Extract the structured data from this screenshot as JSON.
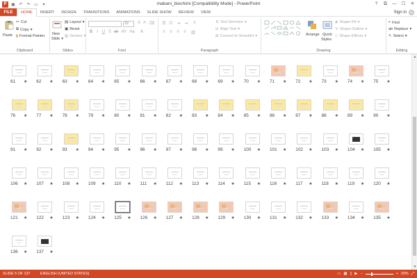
{
  "window": {
    "title": "mabani_biochimi [Compatibility Mode] - PowerPoint",
    "app_logo": "P",
    "qat": [
      "save-icon",
      "undo-icon",
      "redo-icon",
      "present-icon",
      "customize-icon"
    ],
    "controls": [
      "?",
      "⧉",
      "—",
      "☐",
      "✕"
    ]
  },
  "tabs": {
    "file": "FILE",
    "items": [
      "HOME",
      "INSERT",
      "DESIGN",
      "TRANSITIONS",
      "ANIMATIONS",
      "SLIDE SHOW",
      "REVIEW",
      "VIEW"
    ],
    "active": "HOME",
    "signin": "Sign in"
  },
  "ribbon": {
    "clipboard": {
      "label": "Clipboard",
      "paste": "Paste",
      "cut": "Cut",
      "copy": "Copy",
      "format_painter": "Format Painter"
    },
    "slides": {
      "label": "Slides",
      "new_slide": "New",
      "new_slide_2": "Slide",
      "layout": "Layout",
      "reset": "Reset",
      "section": "Section"
    },
    "font": {
      "label": "Font",
      "font_name": "",
      "font_size": "22"
    },
    "paragraph": {
      "label": "Paragraph",
      "text_direction": "Text Direction",
      "align_text": "Align Text",
      "convert_smartart": "Convert to SmartArt"
    },
    "drawing": {
      "label": "Drawing",
      "arrange": "Arrange",
      "quick_styles": "Quick",
      "quick_styles_2": "Styles",
      "shape_fill": "Shape Fill",
      "shape_outline": "Shape Outline",
      "shape_effects": "Shape Effects"
    },
    "editing": {
      "label": "Editing",
      "find": "Find",
      "replace": "Replace",
      "select": "Select"
    }
  },
  "slides": {
    "star": "★",
    "selected": 125,
    "rows": [
      [
        61,
        62,
        63,
        64,
        65,
        66,
        67,
        68,
        69,
        70,
        71,
        72,
        73,
        74,
        75
      ],
      [
        76,
        77,
        78,
        79,
        80,
        81,
        82,
        83,
        84,
        85,
        86,
        87,
        88,
        89,
        90
      ],
      [
        91,
        92,
        93,
        94,
        95,
        96,
        97,
        98,
        99,
        100,
        101,
        102,
        103,
        104,
        105
      ],
      [
        106,
        107,
        108,
        109,
        110,
        111,
        112,
        113,
        114,
        115,
        116,
        117,
        118,
        119,
        120
      ],
      [
        121,
        122,
        123,
        124,
        125,
        126,
        127,
        128,
        129,
        130,
        131,
        132,
        133,
        134,
        135
      ],
      [
        136,
        137
      ]
    ],
    "style_yellow": [
      63,
      72,
      76,
      77,
      78,
      83,
      84,
      85,
      86,
      87,
      88,
      89,
      93
    ],
    "style_orange": [
      71,
      74,
      121,
      126,
      127,
      128,
      129,
      133,
      135
    ],
    "style_dark": [
      104,
      137
    ]
  },
  "status": {
    "slide_info": "SLIDE 5 OF 137",
    "language": "ENGLISH (UNITED STATES)",
    "zoom": "20%",
    "zoom_fraction": 0.2
  },
  "colors": {
    "accent": "#d24726",
    "slide_yellow": "#fbe9a0",
    "slide_orange": "#f6c8b0"
  }
}
